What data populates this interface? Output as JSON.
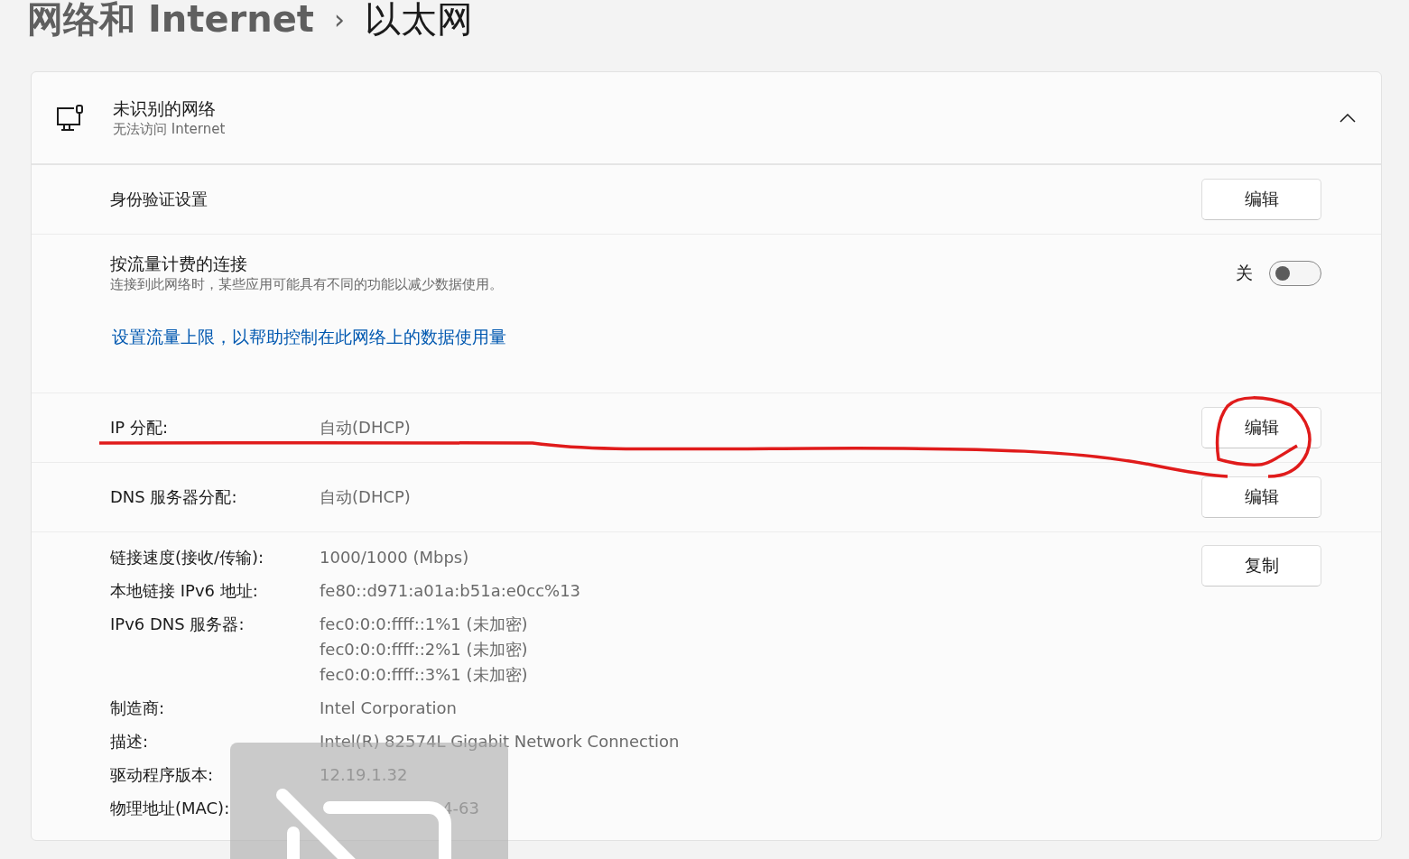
{
  "breadcrumb": {
    "parent": "网络和 Internet",
    "separator": "›",
    "current": "以太网"
  },
  "network": {
    "name": "未识别的网络",
    "status": "无法访问 Internet",
    "expanded": true
  },
  "auth_settings": {
    "label": "身份验证设置",
    "button": "编辑"
  },
  "metered": {
    "label": "按流量计费的连接",
    "description": "连接到此网络时，某些应用可能具有不同的功能以减少数据使用。",
    "state_label": "关",
    "on": false,
    "link": "设置流量上限，以帮助控制在此网络上的数据使用量"
  },
  "ip_assignment": {
    "label": "IP 分配:",
    "value": "自动(DHCP)",
    "button": "编辑"
  },
  "dns_assignment": {
    "label": "DNS 服务器分配:",
    "value": "自动(DHCP)",
    "button": "编辑"
  },
  "details": {
    "button": "复制",
    "rows": [
      {
        "label": "链接速度(接收/传输):",
        "values": [
          "1000/1000 (Mbps)"
        ]
      },
      {
        "label": "本地链接 IPv6 地址:",
        "values": [
          "fe80::d971:a01a:b51a:e0cc%13"
        ]
      },
      {
        "label": "IPv6 DNS 服务器:",
        "values": [
          "fec0:0:0:ffff::1%1 (未加密)",
          "fec0:0:0:ffff::2%1 (未加密)",
          "fec0:0:0:ffff::3%1 (未加密)"
        ]
      },
      {
        "label": "制造商:",
        "values": [
          "Intel Corporation"
        ]
      },
      {
        "label": "描述:",
        "values": [
          "Intel(R) 82574L Gigabit Network Connection"
        ]
      },
      {
        "label": "驱动程序版本:",
        "values": [
          "12.19.1.32"
        ]
      },
      {
        "label": "物理地址(MAC):",
        "values": [
          "4-63"
        ],
        "covered": true
      }
    ]
  }
}
